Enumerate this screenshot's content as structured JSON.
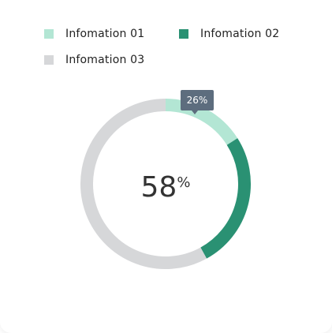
{
  "chart_data": {
    "type": "donut",
    "series": [
      {
        "name": "Infomation 01",
        "value": 16,
        "color": "#b3e6d4"
      },
      {
        "name": "Infomation 02",
        "value": 26,
        "color": "#2a9173"
      },
      {
        "name": "Infomation 03",
        "value": 58,
        "color": "#d6d7d9"
      }
    ],
    "center": {
      "value": "58",
      "unit": "%"
    },
    "callout": {
      "label": "26%",
      "series": "Infomation 02"
    },
    "legend_position": "top-left"
  }
}
